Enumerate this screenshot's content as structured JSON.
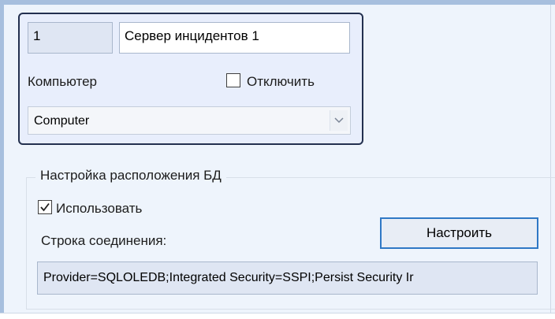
{
  "server": {
    "id": "1",
    "name": "Сервер инцидентов 1",
    "computer_label": "Компьютер",
    "disable_label": "Отключить",
    "disable_checked": false,
    "computer_value": "Computer"
  },
  "db": {
    "group_title": "Настройка расположения БД",
    "use_label": "Использовать",
    "use_checked": true,
    "connection_label": "Строка соединения:",
    "configure_button": "Настроить",
    "connection_value": "Provider=SQLOLEDB;Integrated Security=SSPI;Persist Security Ir"
  },
  "icons": {
    "dropdown": "chevron-down-icon",
    "check": "checkmark-icon"
  },
  "colors": {
    "panel_bg": "#eef4fc",
    "object_border": "#23304f",
    "button_border": "#2f78c5"
  }
}
